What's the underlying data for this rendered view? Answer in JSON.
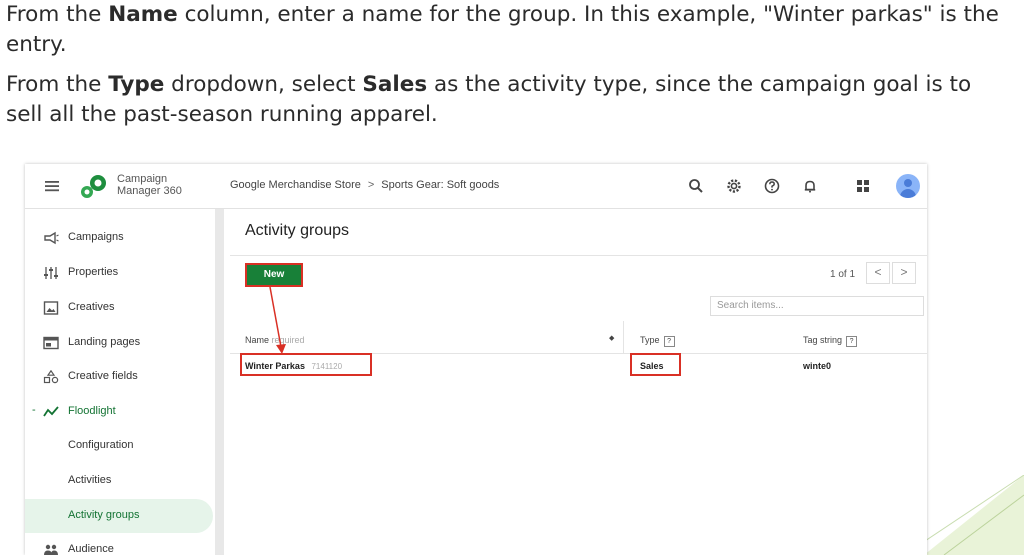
{
  "instructions": {
    "p1": {
      "t1": "From the ",
      "b1": "Name",
      "t2": " column, enter a name for the group. In this example, \"Winter parkas\" is the entry."
    },
    "p2": {
      "t1": "From the ",
      "b1": "Type",
      "t2": " dropdown, select ",
      "b2": "Sales",
      "t3": " as the activity type, since the campaign goal is to sell all the past-season running apparel."
    }
  },
  "app": {
    "brand_line1": "Campaign",
    "brand_line2": "Manager 360",
    "breadcrumb": [
      "Google Merchandise Store",
      "Sports Gear: Soft goods"
    ],
    "breadcrumb_sep": ">"
  },
  "sidebar": {
    "items": [
      {
        "label": "Campaigns",
        "icon": "megaphone-icon"
      },
      {
        "label": "Properties",
        "icon": "sliders-icon"
      },
      {
        "label": "Creatives",
        "icon": "image-icon"
      },
      {
        "label": "Landing pages",
        "icon": "web-page-icon"
      },
      {
        "label": "Creative fields",
        "icon": "shapes-icon"
      },
      {
        "label": "Floodlight",
        "icon": "trend-line-icon"
      },
      {
        "label": "Configuration"
      },
      {
        "label": "Activities"
      },
      {
        "label": "Activity groups"
      },
      {
        "label": "Audience",
        "icon": "people-icon"
      }
    ],
    "expand_marker": "-"
  },
  "main": {
    "title": "Activity groups",
    "new_button": "New",
    "pager": "1 of 1",
    "prev": "<",
    "next": ">",
    "search_placeholder": "Search items...",
    "columns": {
      "name": "Name",
      "name_hint": "required",
      "type": "Type",
      "tag": "Tag string",
      "help": "?"
    },
    "sort_glyph": "◆",
    "row": {
      "name": "Winter Parkas",
      "id": "7141120",
      "type": "Sales",
      "tag": "winte0"
    }
  },
  "colors": {
    "accent_green": "#188038",
    "highlight_red": "#d93025",
    "active_bg": "#e6f4ea"
  }
}
